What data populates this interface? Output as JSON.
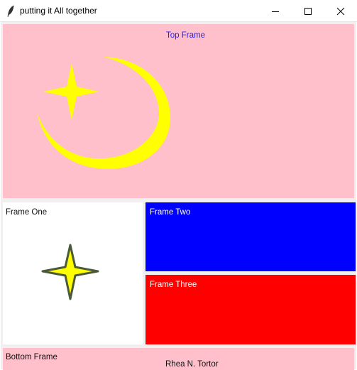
{
  "window": {
    "title": "putting it All together",
    "controls": [
      "minimize",
      "maximize",
      "close"
    ]
  },
  "frames": {
    "top": {
      "label": "Top Frame",
      "color": "#ffc0cb",
      "shapes": [
        "crescent-moon",
        "four-point-star"
      ]
    },
    "one": {
      "label": "Frame One",
      "color": "#ffffff",
      "shapes": [
        "four-point-star"
      ]
    },
    "two": {
      "label": "Frame Two",
      "color": "#0000ff"
    },
    "three": {
      "label": "Frame Three",
      "color": "#ff0000"
    },
    "bottom": {
      "label": "Bottom Frame",
      "author": "Rhea N. Tortor",
      "color": "#ffc0cb"
    }
  },
  "colors": {
    "moon": "#ffff00",
    "star": "#ffff00",
    "star_outline": "#4a5a3a"
  }
}
